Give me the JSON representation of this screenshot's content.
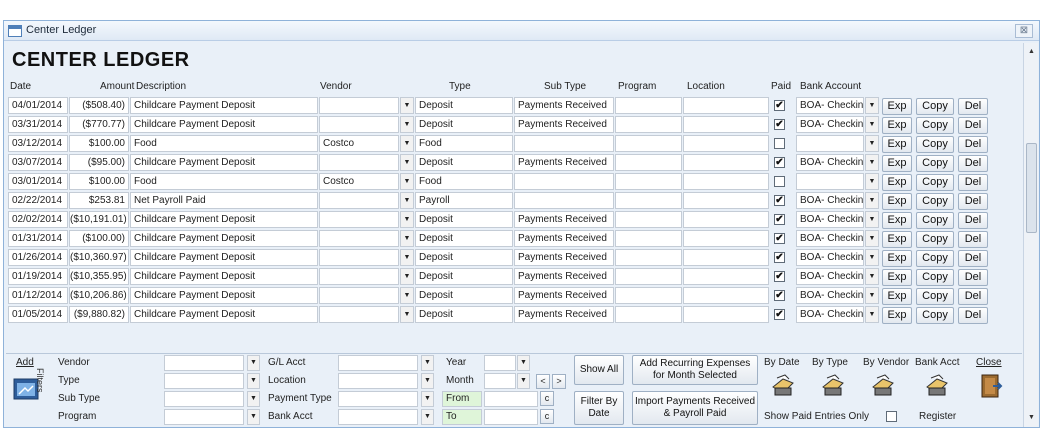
{
  "window": {
    "title": "Center Ledger",
    "close_glyph": "⊠"
  },
  "heading": "CENTER LEDGER",
  "columns": {
    "date": "Date",
    "amount": "Amount",
    "description": "Description",
    "vendor": "Vendor",
    "type": "Type",
    "subtype": "Sub Type",
    "program": "Program",
    "location": "Location",
    "paid": "Paid",
    "bank": "Bank Account"
  },
  "row_buttons": {
    "exp": "Exp",
    "copy": "Copy",
    "del": "Del"
  },
  "rows": [
    {
      "date": "04/01/2014",
      "amount": "($508.40)",
      "description": "Childcare Payment Deposit",
      "vendor": "",
      "type": "Deposit",
      "subtype": "Payments Received",
      "paid": true,
      "bank": "BOA- Checking"
    },
    {
      "date": "03/31/2014",
      "amount": "($770.77)",
      "description": "Childcare Payment Deposit",
      "vendor": "",
      "type": "Deposit",
      "subtype": "Payments Received",
      "paid": true,
      "bank": "BOA- Checking"
    },
    {
      "date": "03/12/2014",
      "amount": "$100.00",
      "description": "Food",
      "vendor": "Costco",
      "type": "Food",
      "subtype": "",
      "paid": false,
      "bank": ""
    },
    {
      "date": "03/07/2014",
      "amount": "($95.00)",
      "description": "Childcare Payment Deposit",
      "vendor": "",
      "type": "Deposit",
      "subtype": "Payments Received",
      "paid": true,
      "bank": "BOA- Checking"
    },
    {
      "date": "03/01/2014",
      "amount": "$100.00",
      "description": "Food",
      "vendor": "Costco",
      "type": "Food",
      "subtype": "",
      "paid": false,
      "bank": ""
    },
    {
      "date": "02/22/2014",
      "amount": "$253.81",
      "description": "Net Payroll Paid",
      "vendor": "",
      "type": "Payroll",
      "subtype": "",
      "paid": true,
      "bank": "BOA- Checking"
    },
    {
      "date": "02/02/2014",
      "amount": "($10,191.01)",
      "description": "Childcare Payment Deposit",
      "vendor": "",
      "type": "Deposit",
      "subtype": "Payments Received",
      "paid": true,
      "bank": "BOA- Checking"
    },
    {
      "date": "01/31/2014",
      "amount": "($100.00)",
      "description": "Childcare Payment Deposit",
      "vendor": "",
      "type": "Deposit",
      "subtype": "Payments Received",
      "paid": true,
      "bank": "BOA- Checking"
    },
    {
      "date": "01/26/2014",
      "amount": "($10,360.97)",
      "description": "Childcare Payment Deposit",
      "vendor": "",
      "type": "Deposit",
      "subtype": "Payments Received",
      "paid": true,
      "bank": "BOA- Checking"
    },
    {
      "date": "01/19/2014",
      "amount": "($10,355.95)",
      "description": "Childcare Payment Deposit",
      "vendor": "",
      "type": "Deposit",
      "subtype": "Payments Received",
      "paid": true,
      "bank": "BOA- Checking"
    },
    {
      "date": "01/12/2014",
      "amount": "($10,206.86)",
      "description": "Childcare Payment Deposit",
      "vendor": "",
      "type": "Deposit",
      "subtype": "Payments Received",
      "paid": true,
      "bank": "BOA- Checking"
    },
    {
      "date": "01/05/2014",
      "amount": "($9,880.82)",
      "description": "Childcare Payment Deposit",
      "vendor": "",
      "type": "Deposit",
      "subtype": "Payments Received",
      "paid": true,
      "bank": "BOA- Checking"
    }
  ],
  "filters": {
    "add_label": "Add",
    "filters_label": "Filters",
    "vendor": "Vendor",
    "type": "Type",
    "subtype": "Sub Type",
    "program": "Program",
    "gl_acct": "G/L Acct",
    "location": "Location",
    "payment_type": "Payment Type",
    "bank_acct": "Bank Acct",
    "year": "Year",
    "month": "Month",
    "from": "From",
    "to": "To",
    "prev_glyph": "<",
    "next_glyph": ">",
    "cal_glyph": "c"
  },
  "buttons": {
    "show_all": "Show All",
    "filter_by_date": "Filter By Date",
    "add_recurring": "Add Recurring Expenses for Month Selected",
    "import_payments": "Import Payments Received & Payroll Paid"
  },
  "reports": {
    "by_date": "By Date",
    "by_type": "By Type",
    "by_vendor": "By Vendor",
    "bank_acct": "Bank Acct",
    "register": "Register",
    "close": "Close",
    "show_paid_only": "Show Paid Entries Only"
  },
  "icons": {
    "dropdown": "▼",
    "check": "✔",
    "scroll_up": "▲",
    "scroll_down": "▼"
  },
  "colors": {
    "accent": "#4f7fb8",
    "background": "#e9f0f8",
    "date_filter": "#dff5d9"
  }
}
